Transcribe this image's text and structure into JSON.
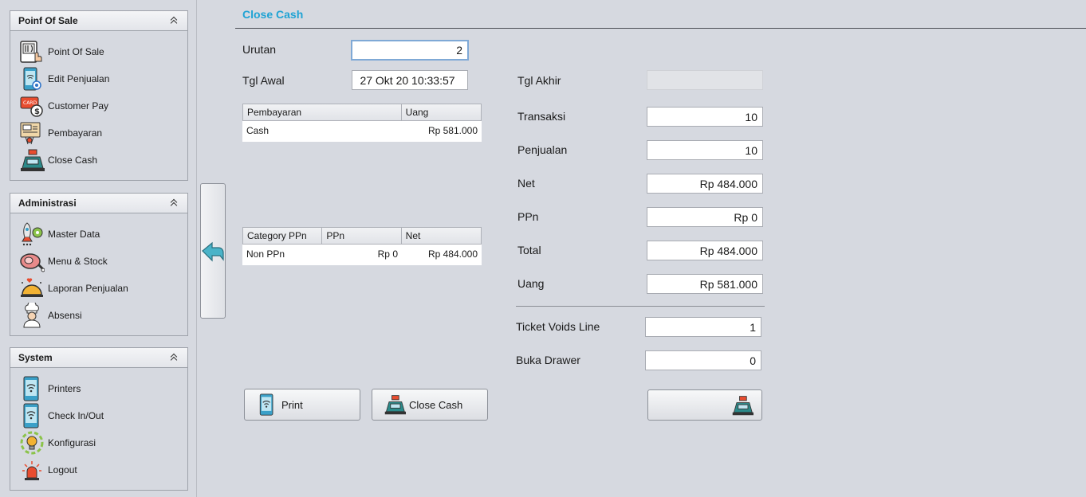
{
  "sidebar": {
    "panels": [
      {
        "title": "Poinf Of Sale",
        "items": [
          {
            "label": "Point Of Sale",
            "icon": "pos-terminal-icon"
          },
          {
            "label": "Edit Penjualan",
            "icon": "phone-edit-icon"
          },
          {
            "label": "Customer Pay",
            "icon": "card-payment-icon"
          },
          {
            "label": "Pembayaran",
            "icon": "payment-monitor-icon"
          },
          {
            "label": "Close Cash",
            "icon": "cash-register-icon"
          }
        ]
      },
      {
        "title": "Administrasi",
        "items": [
          {
            "label": "Master Data",
            "icon": "rocket-gear-icon"
          },
          {
            "label": "Menu & Stock",
            "icon": "meat-icon"
          },
          {
            "label": "Laporan Penjualan",
            "icon": "food-cloche-icon"
          },
          {
            "label": "Absensi",
            "icon": "chef-icon"
          }
        ]
      },
      {
        "title": "System",
        "items": [
          {
            "label": "Printers",
            "icon": "phone-wifi-icon"
          },
          {
            "label": "Check In/Out",
            "icon": "phone-wifi-icon"
          },
          {
            "label": "Konfigurasi",
            "icon": "lightbulb-gear-icon"
          },
          {
            "label": "Logout",
            "icon": "siren-icon"
          }
        ]
      }
    ]
  },
  "main": {
    "title": "Close Cash",
    "urutan_label": "Urutan",
    "urutan_value": "2",
    "tgl_awal_label": "Tgl Awal",
    "tgl_awal_value": "27 Okt 20 10:33:57",
    "tgl_akhir_label": "Tgl Akhir",
    "tgl_akhir_value": "",
    "payment_table": {
      "headers": [
        "Pembayaran",
        "Uang"
      ],
      "rows": [
        [
          "Cash",
          "Rp 581.000"
        ]
      ]
    },
    "tax_table": {
      "headers": [
        "Category PPn",
        "PPn",
        "Net"
      ],
      "rows": [
        [
          "Non PPn",
          "Rp 0",
          "Rp 484.000"
        ]
      ]
    },
    "summary": {
      "transaksi_label": "Transaksi",
      "transaksi_value": "10",
      "penjualan_label": "Penjualan",
      "penjualan_value": "10",
      "net_label": "Net",
      "net_value": "Rp 484.000",
      "ppn_label": "PPn",
      "ppn_value": "Rp 0",
      "total_label": "Total",
      "total_value": "Rp 484.000",
      "uang_label": "Uang",
      "uang_value": "Rp 581.000",
      "ticket_voids_label": "Ticket Voids Line",
      "ticket_voids_value": "1",
      "buka_drawer_label": "Buka Drawer",
      "buka_drawer_value": "0"
    },
    "buttons": {
      "print_label": "Print",
      "close_cash_label": "Close Cash"
    }
  },
  "colors": {
    "title": "#1fa3d4",
    "background": "#d6d9e0",
    "arrow": "#4ab3c8"
  }
}
